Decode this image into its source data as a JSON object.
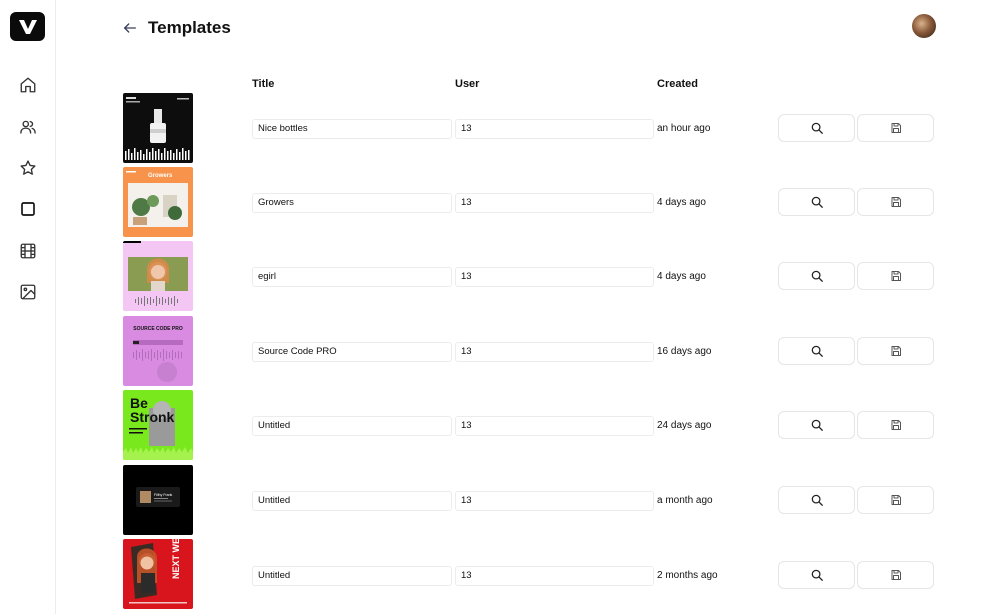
{
  "header": {
    "title": "Templates"
  },
  "columns": {
    "title": "Title",
    "user": "User",
    "created": "Created"
  },
  "thumbnails": {
    "t4_heading": "SOURCE CODE PRO",
    "t5_heading_1": "Be",
    "t5_heading_2": "Stronk",
    "t6_name": "Filthy Frank",
    "t7_heading": "NEXT WE EPISO"
  },
  "rows": [
    {
      "title": "Nice bottles",
      "user": "13",
      "created": "an hour ago"
    },
    {
      "title": "Growers",
      "user": "13",
      "created": "4 days ago"
    },
    {
      "title": "egirl",
      "user": "13",
      "created": "4 days ago"
    },
    {
      "title": "Source Code PRO",
      "user": "13",
      "created": "16 days ago"
    },
    {
      "title": "Untitled",
      "user": "13",
      "created": "24 days ago"
    },
    {
      "title": "Untitled",
      "user": "13",
      "created": "a month ago"
    },
    {
      "title": "Untitled",
      "user": "13",
      "created": "2 months ago"
    }
  ]
}
